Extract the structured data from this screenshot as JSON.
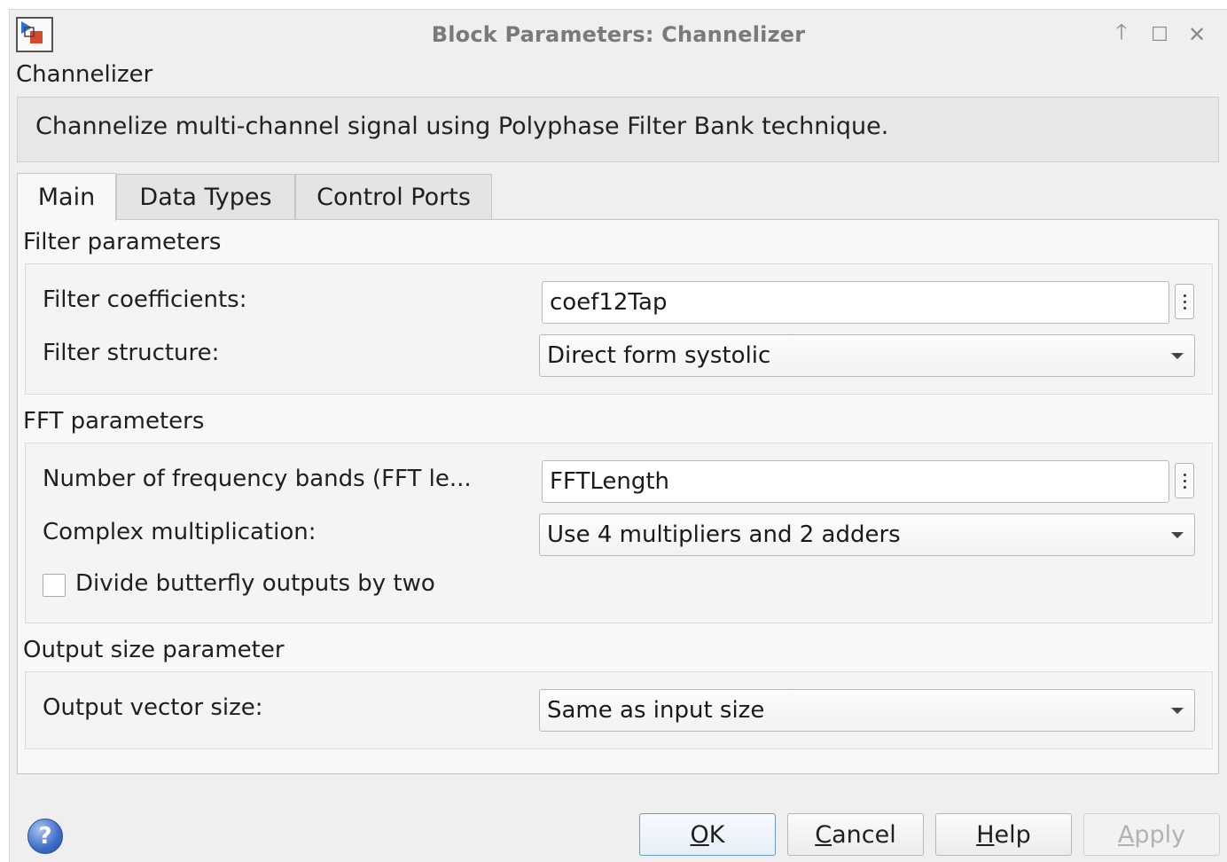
{
  "window": {
    "title": "Block Parameters: Channelizer",
    "controls": {
      "pin": "🡑",
      "maximize": "☐",
      "close": "✕"
    }
  },
  "block": {
    "name": "Channelizer",
    "description": "Channelize multi-channel signal using Polyphase Filter Bank technique."
  },
  "tabs": [
    {
      "label": "Main",
      "active": true
    },
    {
      "label": "Data Types",
      "active": false
    },
    {
      "label": "Control Ports",
      "active": false
    }
  ],
  "filter_parameters": {
    "title": "Filter parameters",
    "coefficients_label": "Filter coefficients:",
    "coefficients_value": "coef12Tap",
    "structure_label": "Filter structure:",
    "structure_value": "Direct form systolic"
  },
  "fft_parameters": {
    "title": "FFT parameters",
    "bands_label": "Number of frequency bands (FFT le...",
    "bands_value": "FFTLength",
    "complex_mult_label": "Complex multiplication:",
    "complex_mult_value": "Use 4 multipliers and 2 adders",
    "divide_label": "Divide butterfly outputs by two",
    "divide_checked": false
  },
  "output_parameters": {
    "title": "Output size parameter",
    "vector_size_label": "Output vector size:",
    "vector_size_value": "Same as input size"
  },
  "footer": {
    "help_icon": "?",
    "ok": {
      "mnemonic": "O",
      "rest": "K"
    },
    "cancel": {
      "mnemonic": "C",
      "rest": "ancel"
    },
    "help": {
      "mnemonic": "H",
      "rest": "elp"
    },
    "apply": {
      "mnemonic": "A",
      "rest": "pply"
    }
  }
}
